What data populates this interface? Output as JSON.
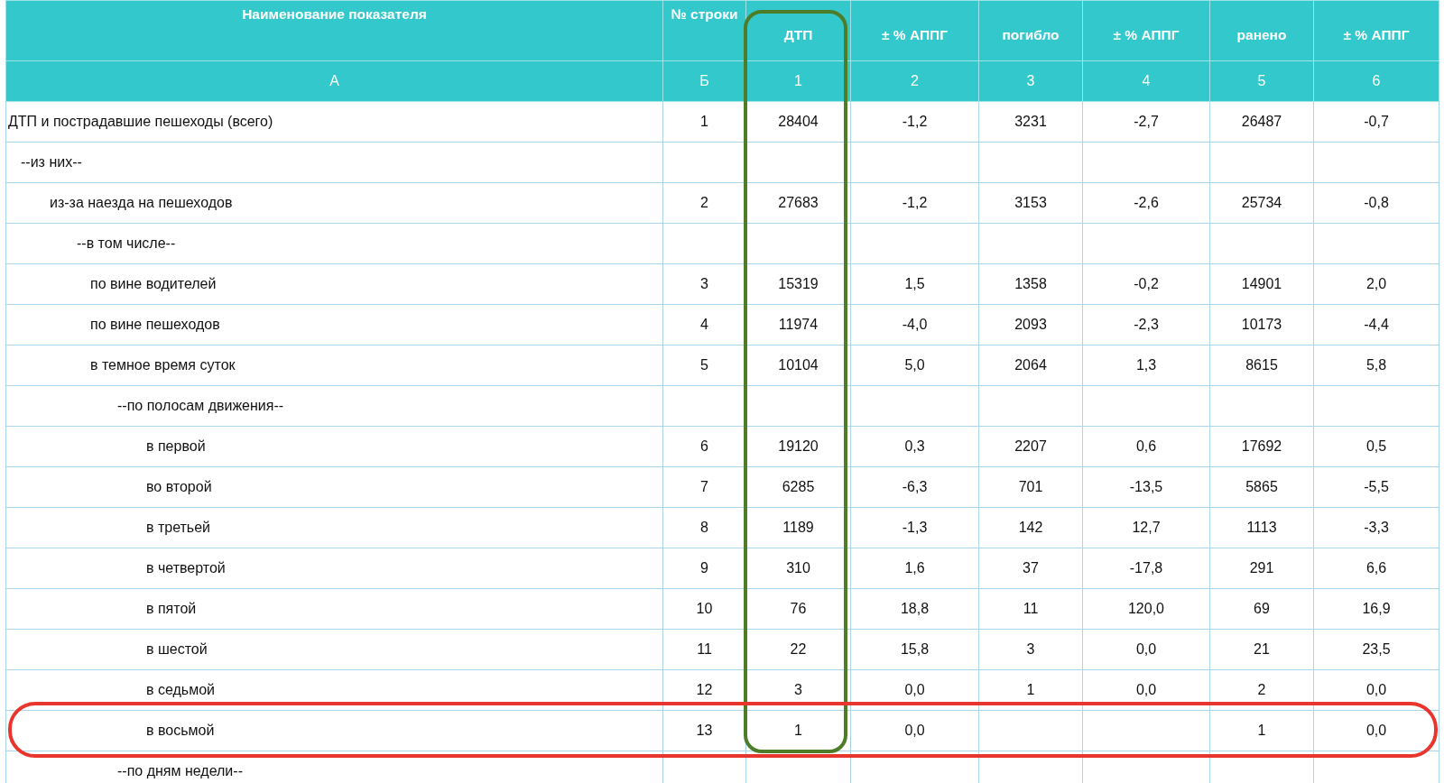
{
  "table": {
    "columns": [
      {
        "title": "Наименование показателя",
        "code": "А",
        "highlighted": false
      },
      {
        "title": "№ строки",
        "code": "Б",
        "highlighted": false
      },
      {
        "title": "ДТП",
        "code": "1",
        "highlighted": true
      },
      {
        "title": "± % АППГ",
        "code": "2",
        "highlighted": false
      },
      {
        "title": "погибло",
        "code": "3",
        "highlighted": false
      },
      {
        "title": "± % АППГ",
        "code": "4",
        "highlighted": false
      },
      {
        "title": "ранено",
        "code": "5",
        "highlighted": false
      },
      {
        "title": "± % АППГ",
        "code": "6",
        "highlighted": false
      }
    ],
    "rows": [
      {
        "name": "ДТП и пострадавшие пешеходы (всего)",
        "line": "1",
        "values": {
          "1": "28404",
          "2": "-1,2",
          "3": "3231",
          "4": "-2,7",
          "5": "26487",
          "6": "-0,7"
        },
        "highlighted": false,
        "children": [
          {
            "name": "--из них--",
            "highlighted": false,
            "children": [
              {
                "name": "из-за наезда на пешеходов",
                "line": "2",
                "values": {
                  "1": "27683",
                  "2": "-1,2",
                  "3": "3153",
                  "4": "-2,6",
                  "5": "25734",
                  "6": "-0,8"
                },
                "highlighted": false,
                "children": [
                  {
                    "name": "--в том числе--",
                    "highlighted": false,
                    "children": [
                      {
                        "name": "по вине водителей",
                        "line": "3",
                        "values": {
                          "1": "15319",
                          "2": "1,5",
                          "3": "1358",
                          "4": "-0,2",
                          "5": "14901",
                          "6": "2,0"
                        },
                        "highlighted": false
                      },
                      {
                        "name": "по вине пешеходов",
                        "line": "4",
                        "values": {
                          "1": "11974",
                          "2": "-4,0",
                          "3": "2093",
                          "4": "-2,3",
                          "5": "10173",
                          "6": "-4,4"
                        },
                        "highlighted": false
                      },
                      {
                        "name": "в темное время суток",
                        "line": "5",
                        "values": {
                          "1": "10104",
                          "2": "5,0",
                          "3": "2064",
                          "4": "1,3",
                          "5": "8615",
                          "6": "5,8"
                        },
                        "highlighted": false,
                        "children": [
                          {
                            "name": "--по полосам движения--",
                            "highlighted": false,
                            "children": [
                              {
                                "name": "в первой",
                                "line": "6",
                                "values": {
                                  "1": "19120",
                                  "2": "0,3",
                                  "3": "2207",
                                  "4": "0,6",
                                  "5": "17692",
                                  "6": "0,5"
                                },
                                "highlighted": false
                              },
                              {
                                "name": "во второй",
                                "line": "7",
                                "values": {
                                  "1": "6285",
                                  "2": "-6,3",
                                  "3": "701",
                                  "4": "-13,5",
                                  "5": "5865",
                                  "6": "-5,5"
                                },
                                "highlighted": false
                              },
                              {
                                "name": "в третьей",
                                "line": "8",
                                "values": {
                                  "1": "1189",
                                  "2": "-1,3",
                                  "3": "142",
                                  "4": "12,7",
                                  "5": "1113",
                                  "6": "-3,3"
                                },
                                "highlighted": false
                              },
                              {
                                "name": "в четвертой",
                                "line": "9",
                                "values": {
                                  "1": "310",
                                  "2": "1,6",
                                  "3": "37",
                                  "4": "-17,8",
                                  "5": "291",
                                  "6": "6,6"
                                },
                                "highlighted": false
                              },
                              {
                                "name": "в пятой",
                                "line": "10",
                                "values": {
                                  "1": "76",
                                  "2": "18,8",
                                  "3": "11",
                                  "4": "120,0",
                                  "5": "69",
                                  "6": "16,9"
                                },
                                "highlighted": false
                              },
                              {
                                "name": "в шестой",
                                "line": "11",
                                "values": {
                                  "1": "22",
                                  "2": "15,8",
                                  "3": "3",
                                  "4": "0,0",
                                  "5": "21",
                                  "6": "23,5"
                                },
                                "highlighted": false
                              },
                              {
                                "name": "в седьмой",
                                "line": "12",
                                "values": {
                                  "1": "3",
                                  "2": "0,0",
                                  "3": "1",
                                  "4": "0,0",
                                  "5": "2",
                                  "6": "0,0"
                                },
                                "highlighted": false
                              },
                              {
                                "name": "в восьмой",
                                "line": "13",
                                "values": {
                                  "1": "1",
                                  "2": "0,0",
                                  "5": "1",
                                  "6": "0,0"
                                },
                                "highlighted": true
                              }
                            ]
                          },
                          {
                            "name": "--по дням недели--",
                            "highlighted": false
                          }
                        ]
                      }
                    ]
                  }
                ]
              }
            ]
          }
        ]
      }
    ]
  }
}
